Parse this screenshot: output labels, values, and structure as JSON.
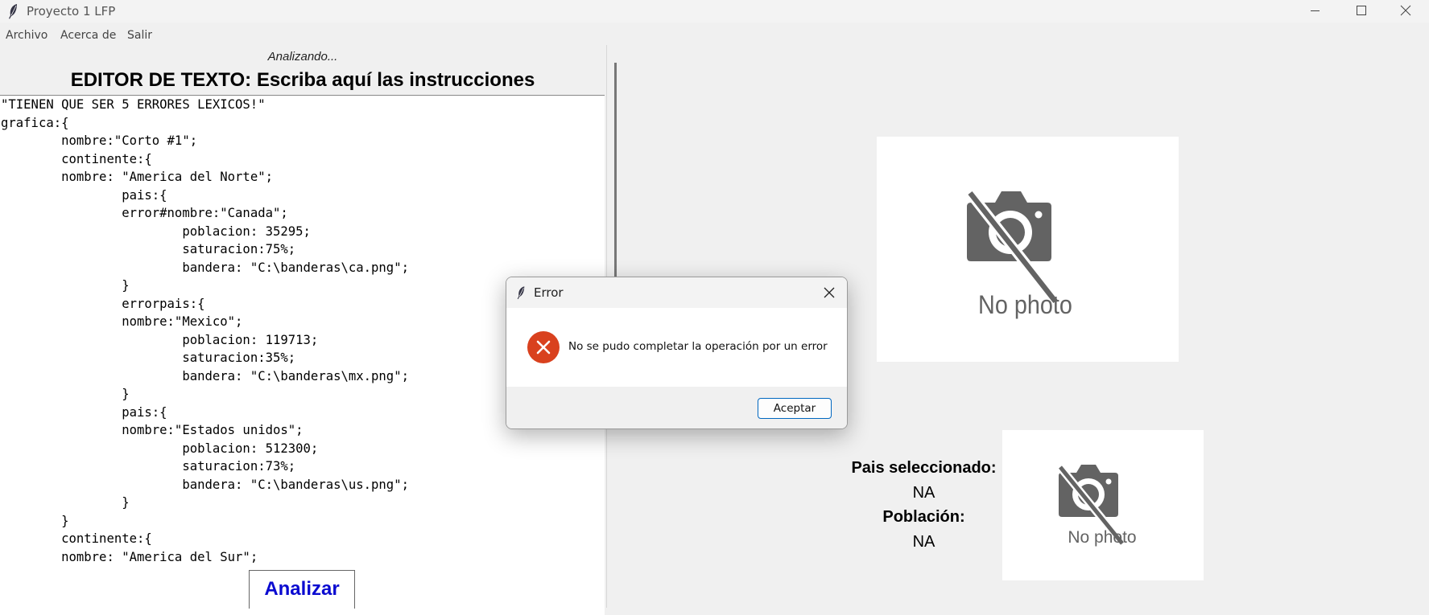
{
  "window": {
    "title": "Proyecto 1 LFP"
  },
  "menu": [
    "Archivo",
    "Acerca de",
    "Salir"
  ],
  "editor": {
    "status": "Analizando...",
    "title": "EDITOR DE TEXTO: Escriba aquí las instrucciones",
    "lines": [
      "\"TIENEN QUE SER 5 ERRORES LEXICOS!\"",
      "grafica:{",
      "\tnombre:\"Corto #1\";",
      "\tcontinente:{",
      "\tnombre: \"America del Norte\";",
      "\t\tpais:{",
      "\t\terror#nombre:\"Canada\";",
      "\t\t\tpoblacion: 35295;",
      "\t\t\tsaturacion:75%;",
      "\t\t\tbandera: \"C:\\banderas\\ca.png\";",
      "\t\t}",
      "\t\terrorpais:{",
      "\t\tnombre:\"Mexico\";",
      "\t\t\tpoblacion: 119713;",
      "\t\t\tsaturacion:35%;",
      "\t\t\tbandera: \"C:\\banderas\\mx.png\";",
      "\t\t}",
      "\t\tpais:{",
      "\t\tnombre:\"Estados unidos\";",
      "\t\t\tpoblacion: 512300;",
      "\t\t\tsaturacion:73%;",
      "\t\t\tbandera: \"C:\\banderas\\us.png\";",
      "\t\t}",
      "\t}",
      "\tcontinente:{",
      "\tnombre: \"America del Sur\";"
    ],
    "analyze_label": "Analizar"
  },
  "right": {
    "photo_placeholder": "No photo",
    "pais_label": "Pais seleccionado:",
    "pais_value": "NA",
    "poblacion_label": "Población:",
    "poblacion_value": "NA"
  },
  "dialog": {
    "title": "Error",
    "message": "No se pudo completar la operación por un error",
    "ok_label": "Aceptar"
  }
}
